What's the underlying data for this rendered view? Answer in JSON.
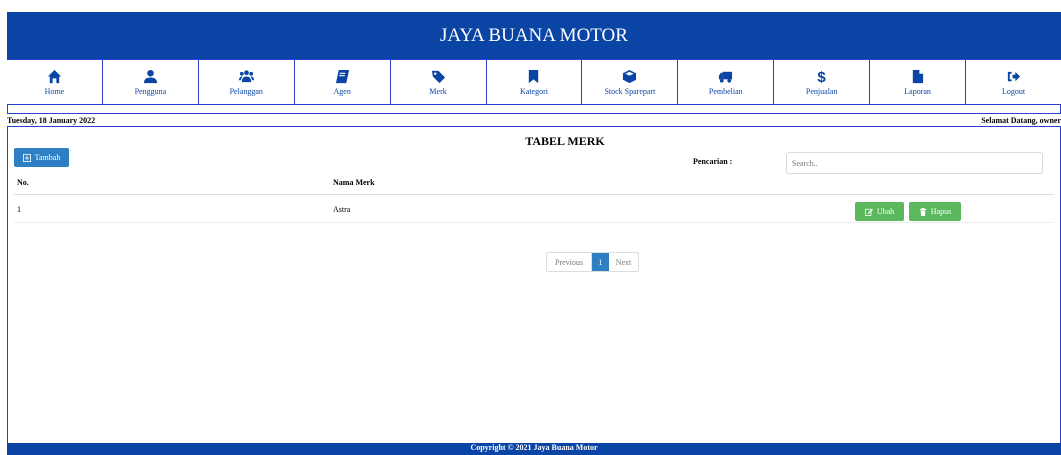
{
  "app": {
    "title": "JAYA BUANA MOTOR"
  },
  "nav": [
    {
      "label": "Home",
      "icon": "home-icon"
    },
    {
      "label": "Pengguna",
      "icon": "user-icon"
    },
    {
      "label": "Pelanggan",
      "icon": "users-icon"
    },
    {
      "label": "Agen",
      "icon": "book-icon"
    },
    {
      "label": "Merk",
      "icon": "tags-icon"
    },
    {
      "label": "Kategori",
      "icon": "bookmark-icon"
    },
    {
      "label": "Stock Sparepart",
      "icon": "cube-icon"
    },
    {
      "label": "Pembelian",
      "icon": "truck-icon"
    },
    {
      "label": "Penjualan",
      "icon": "dollar-icon"
    },
    {
      "label": "Laporan",
      "icon": "file-icon"
    },
    {
      "label": "Logout",
      "icon": "logout-icon"
    }
  ],
  "info": {
    "date": "Tuesday, 18 January 2022",
    "welcome": "Selamat Datang, owner"
  },
  "main": {
    "title": "TABEL MERK",
    "add_label": "Tambah",
    "search_label": "Pencarian :",
    "search_placeholder": "Search..",
    "columns": [
      "No.",
      "Nama Merk"
    ],
    "rows": [
      {
        "no": "1",
        "nama": "Astra"
      }
    ],
    "edit_label": "Ubah",
    "delete_label": "Hapus"
  },
  "pagination": {
    "prev": "Previous",
    "current": "1",
    "next": "Next"
  },
  "footer": {
    "text": "Copyright © 2021 Jaya Buana Motor"
  },
  "colors": {
    "primary": "#0a44a4",
    "button_blue": "#2f7fc4",
    "button_green": "#5cb85c"
  }
}
